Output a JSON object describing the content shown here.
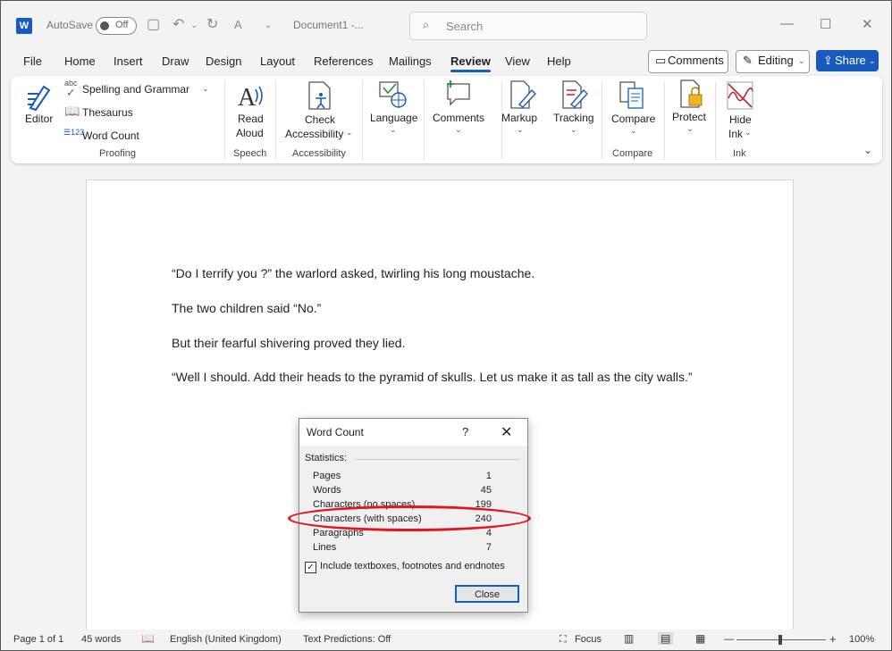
{
  "titlebar": {
    "autosave_label": "AutoSave",
    "autosave_state": "Off",
    "document_title": "Document1  -...",
    "search_placeholder": "Search",
    "minimize": "—",
    "maximize": "☐",
    "close": "✕"
  },
  "menu": {
    "tabs": [
      "File",
      "Home",
      "Insert",
      "Draw",
      "Design",
      "Layout",
      "References",
      "Mailings",
      "Review",
      "View",
      "Help"
    ],
    "active_tab": "Review",
    "comments_label": "Comments",
    "editing_label": "Editing",
    "share_label": "Share"
  },
  "ribbon": {
    "editor_label": "Editor",
    "spelling_label": "Spelling and Grammar",
    "thesaurus_label": "Thesaurus",
    "wordcount_label": "Word Count",
    "proofing_group": "Proofing",
    "read_aloud_label_1": "Read",
    "read_aloud_label_2": "Aloud",
    "speech_group": "Speech",
    "check_access_label_1": "Check",
    "check_access_label_2": "Accessibility",
    "accessibility_group": "Accessibility",
    "language_label": "Language",
    "comments_label": "Comments",
    "markup_label": "Markup",
    "tracking_label": "Tracking",
    "compare_label": "Compare",
    "compare_group": "Compare",
    "protect_label": "Protect",
    "hide_ink_label_1": "Hide",
    "hide_ink_label_2": "Ink",
    "ink_group": "Ink"
  },
  "document": {
    "paragraphs": [
      "“Do I terrify you ?” the warlord asked, twirling his long moustache.",
      "The two children said “No.”",
      "But their fearful shivering proved they lied.",
      "“Well I should. Add their heads to the pyramid of skulls. Let us make it as tall as the city walls.”"
    ]
  },
  "dialog": {
    "title": "Word Count",
    "help": "?",
    "close_x": "✕",
    "statistics_label": "Statistics:",
    "rows": [
      {
        "label": "Pages",
        "value": "1"
      },
      {
        "label": "Words",
        "value": "45"
      },
      {
        "label": "Characters (no spaces)",
        "value": "199"
      },
      {
        "label": "Characters (with spaces)",
        "value": "240"
      },
      {
        "label": "Paragraphs",
        "value": "4"
      },
      {
        "label": "Lines",
        "value": "7"
      }
    ],
    "include_label": "Include textboxes, footnotes and endnotes",
    "include_checked": true,
    "close_button": "Close",
    "highlight_color": "#e0171c"
  },
  "statusbar": {
    "page": "Page 1 of 1",
    "words": "45 words",
    "language": "English (United Kingdom)",
    "text_predictions": "Text Predictions: Off",
    "focus": "Focus",
    "zoom_minus": "—",
    "zoom_plus": "+",
    "zoom": "100%"
  },
  "colors": {
    "accent": "#185abd",
    "highlight": "#e0171c"
  }
}
